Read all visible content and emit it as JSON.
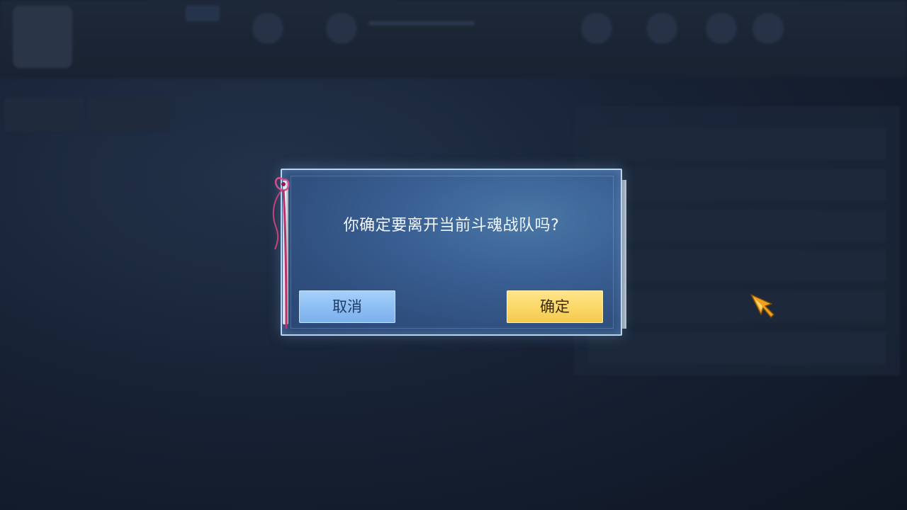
{
  "dialog": {
    "message": "你确定要离开当前斗魂战队吗?",
    "cancel_label": "取消",
    "confirm_label": "确定"
  },
  "colors": {
    "dialog_background": "#3a6094",
    "cancel_button": "#8cbdf3",
    "confirm_button": "#fbd766",
    "overlay": "#141c2b"
  },
  "icons": {
    "cursor": "golden-arrow-cursor-icon",
    "ribbon": "pink-ribbon-icon"
  }
}
